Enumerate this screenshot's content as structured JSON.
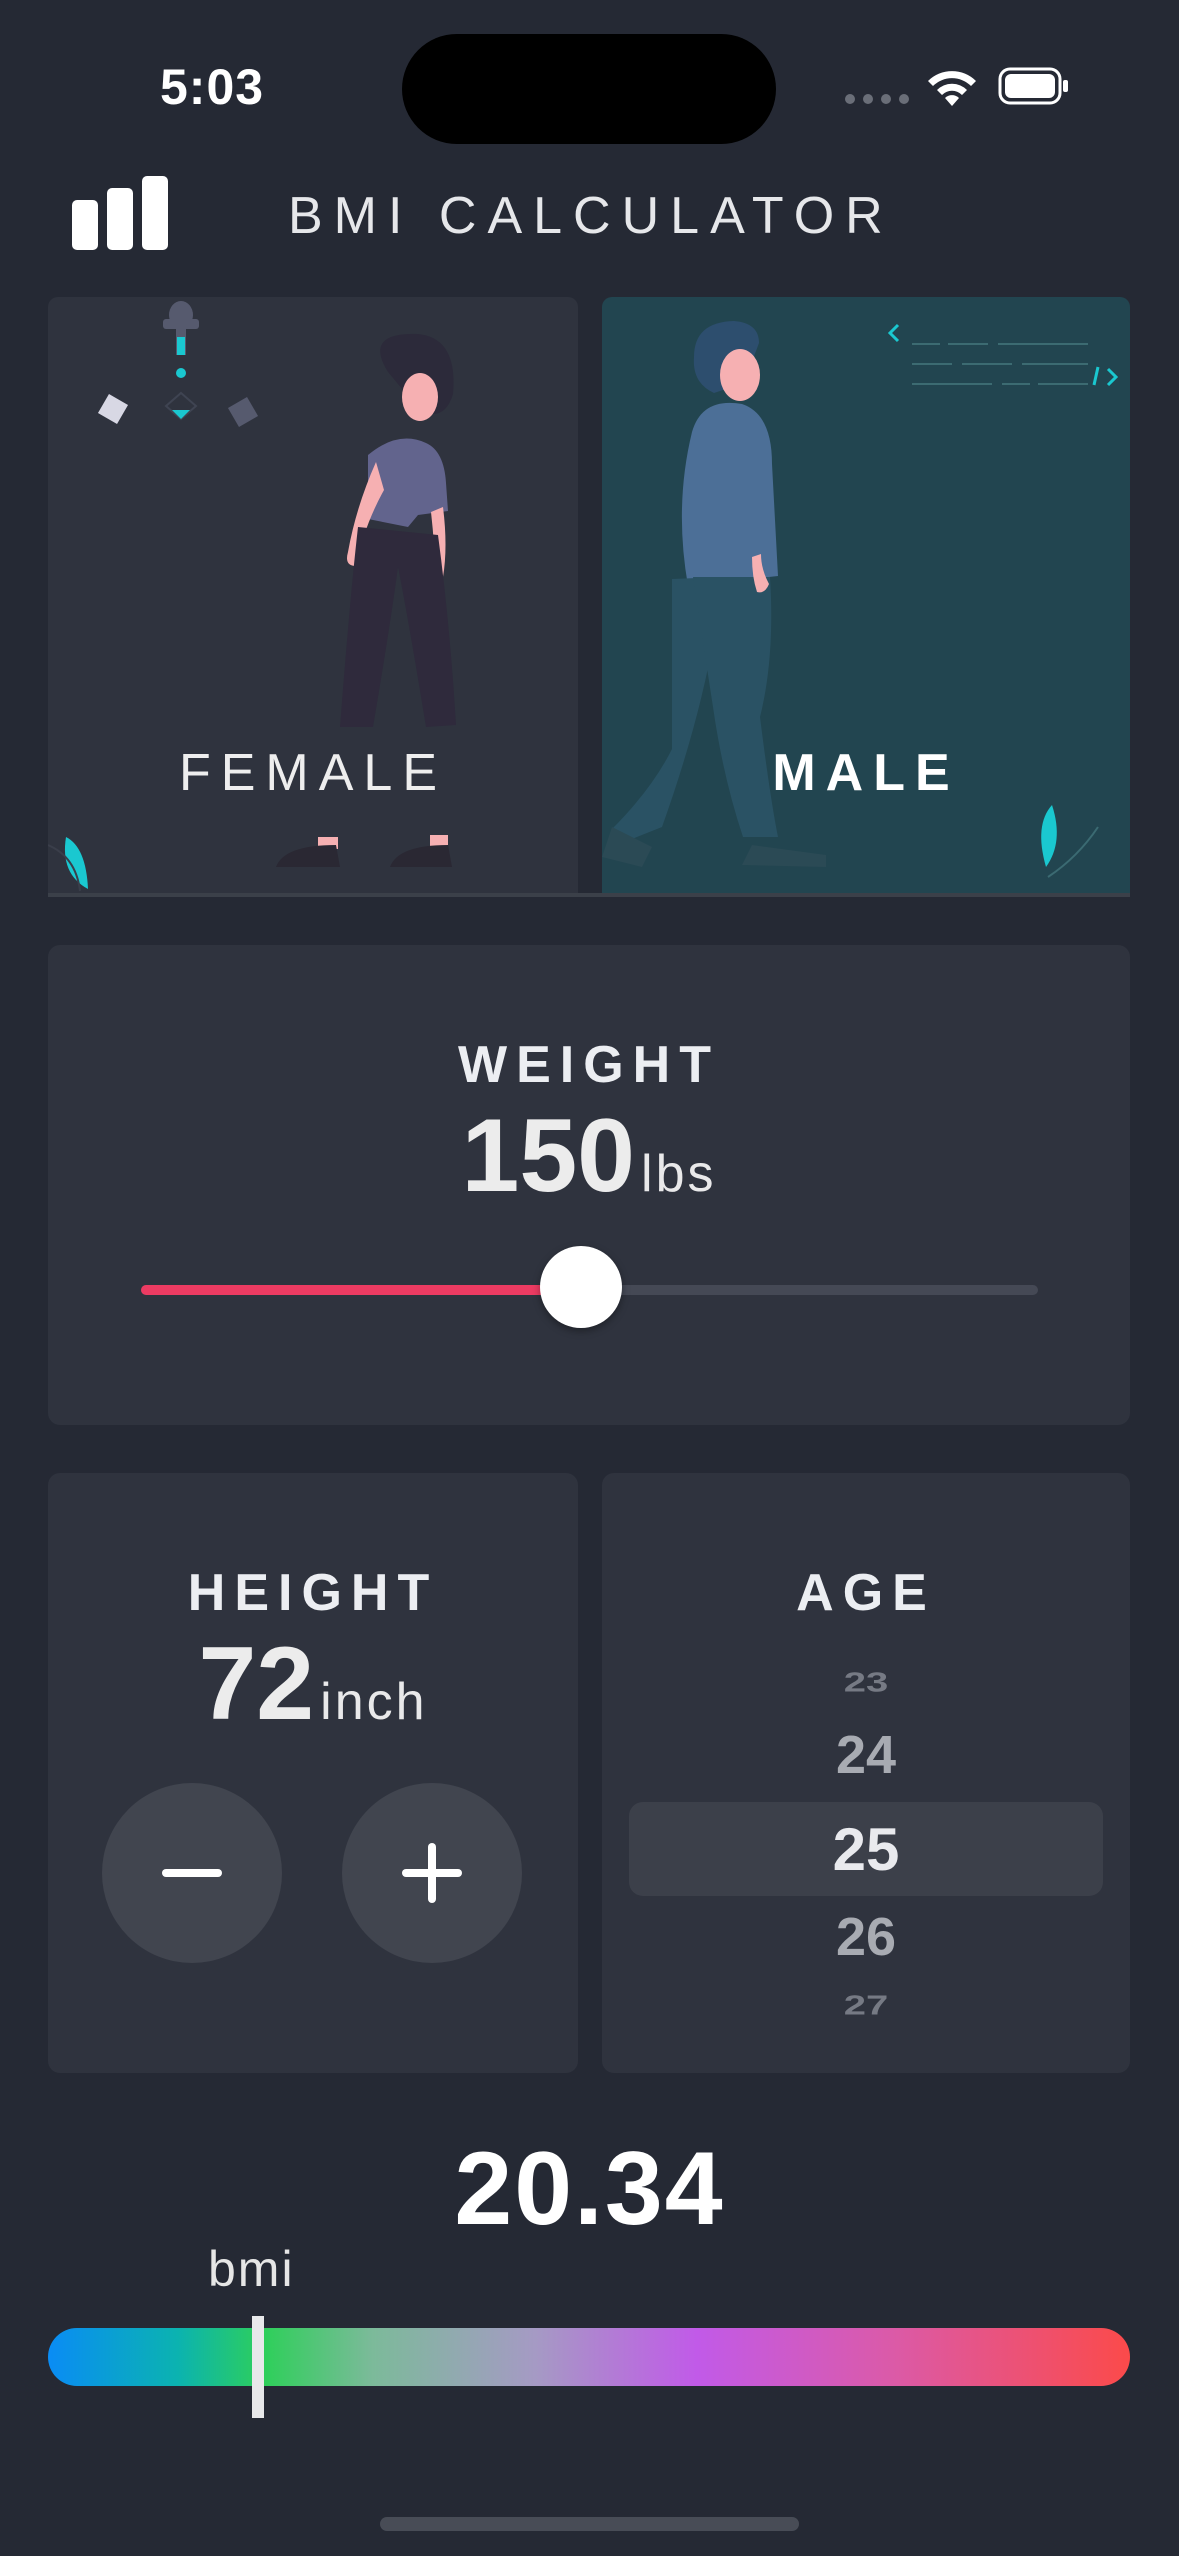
{
  "status_bar": {
    "time": "5:03"
  },
  "header": {
    "title": "BMI CALCULATOR",
    "icon": "bar-chart-icon"
  },
  "gender": {
    "female_label": "FEMALE",
    "male_label": "MALE",
    "selected": "male"
  },
  "weight": {
    "label": "WEIGHT",
    "value": "150",
    "unit": "lbs",
    "slider_fraction": 0.49
  },
  "height": {
    "label": "HEIGHT",
    "value": "72",
    "unit": "inch",
    "minus_icon": "minus-icon",
    "plus_icon": "plus-icon"
  },
  "age": {
    "label": "AGE",
    "options": [
      "23",
      "24",
      "25",
      "26",
      "27"
    ],
    "selected": "25"
  },
  "result": {
    "bmi_value": "20.34",
    "bmi_label": "bmi",
    "marker_fraction": 0.2
  },
  "colors": {
    "background": "#252934",
    "card": "#2f333e",
    "accent": "#ec3b62",
    "male_card": "#224550",
    "teal": "#1ac8d0"
  }
}
